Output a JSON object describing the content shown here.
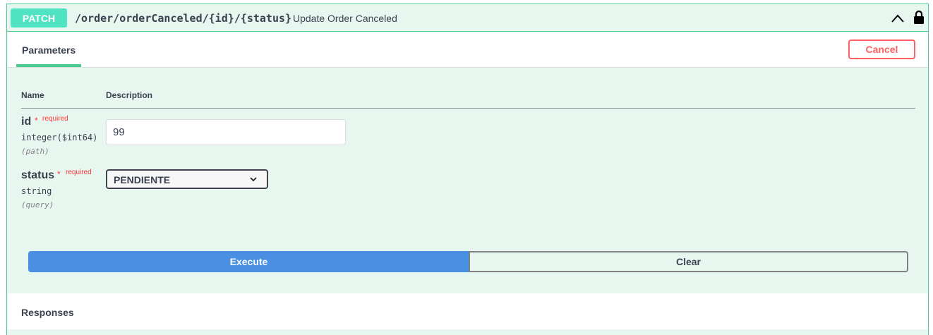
{
  "operation": {
    "method": "PATCH",
    "path": "/order/orderCanceled/{id}/{status}",
    "summary": "Update Order Canceled",
    "icons": [
      "chevron-up-icon",
      "lock-icon"
    ]
  },
  "section": {
    "tab_label": "Parameters",
    "cancel_label": "Cancel"
  },
  "table": {
    "col_name": "Name",
    "col_description": "Description"
  },
  "parameters": [
    {
      "name": "id",
      "star": "*",
      "required": "required",
      "type": "integer($int64)",
      "in": "(path)",
      "value": "99"
    },
    {
      "name": "status",
      "star": "*",
      "required": "required",
      "type": "string",
      "in": "(query)",
      "selected": "PENDIENTE"
    }
  ],
  "actions": {
    "execute_label": "Execute",
    "clear_label": "Clear"
  },
  "responses": {
    "title": "Responses"
  },
  "colors": {
    "accent": "#49cc90",
    "method_badge": "#50e3c2",
    "execute": "#4990e2",
    "cancel": "#ff6060",
    "required": "#ff3535"
  }
}
